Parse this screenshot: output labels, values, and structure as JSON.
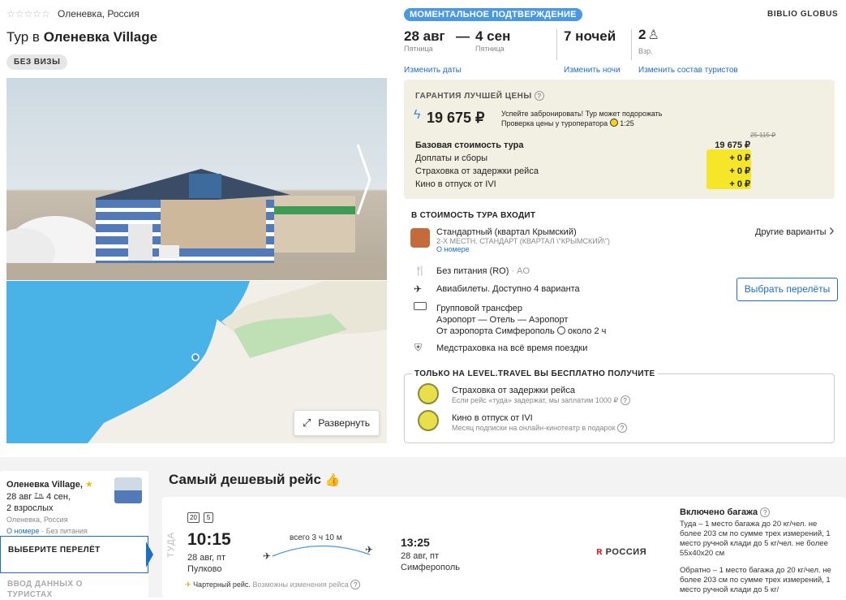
{
  "hotel": {
    "stars": "☆☆☆☆☆",
    "location": "Оленевка, Россия",
    "title_prefix": "Тур в",
    "title_name": "Оленевка Village",
    "visa_badge": "БЕЗ ВИЗЫ",
    "expand_label": "Развернуть"
  },
  "booking": {
    "instant_badge": "МОМЕНТАЛЬНОЕ ПОДТВЕРЖДЕНИЕ",
    "operator": "BIBLIO GLOBUS",
    "date_from": "28 авг",
    "date_from_day": "Пятница",
    "date_dash": "—",
    "date_to": "4 сен",
    "date_to_day": "Пятница",
    "nights": "7 ночей",
    "tourists_count": "2",
    "tourists_label": "Взр.",
    "change_dates": "Изменить даты",
    "change_nights": "Изменить ночи",
    "change_tourists": "Изменить состав туристов"
  },
  "price": {
    "guarantee": "ГАРАНТИЯ ЛУЧШЕЙ ЦЕНЫ",
    "qmark": "?",
    "main": "19 675 ₽",
    "warn_line1": "Успейте забронировать! Тур может подорожать",
    "warn_line2": "Проверка цены у туроператора",
    "warn_time": "1:25",
    "old_price": "25 115 ₽",
    "rows": [
      {
        "label": "Базовая стоимость тура",
        "value": "19 675 ₽"
      },
      {
        "label": "Доплаты и сборы",
        "value": "+ 0 ₽"
      },
      {
        "label": "Страховка от задержки рейса",
        "value": "+ 0 ₽"
      },
      {
        "label": "Кино в отпуск от IVI",
        "value": "+ 0 ₽"
      }
    ]
  },
  "included": {
    "heading": "В СТОИМОСТЬ ТУРА ВХОДИТ",
    "room": "Стандартный (квартал Крымский)",
    "room_sub": "2-Х МЕСТН. СТАНДАРТ (КВАРТАЛ \\\"КРЫМСКИЙ\\\")",
    "room_link": "О номере",
    "other_variants": "Другие варианты",
    "meal": "Без питания (RO)",
    "meal_code": "· AO",
    "flights": "Авиабилеты. Доступно 4 варианта",
    "choose_flights": "Выбрать перелёты",
    "transfer": "Групповой трансфер",
    "transfer_route": "Аэропорт — Отель — Аэропорт",
    "transfer_from": "От аэропорта Симферополь",
    "transfer_time": "около 2 ч",
    "insurance": "Медстраховка на всё время поездки"
  },
  "bonus": {
    "heading": "ТОЛЬКО НА LEVEL.TRAVEL ВЫ БЕСПЛАТНО ПОЛУЧИТЕ",
    "item1": "Страховка от задержки рейса",
    "item1_sub": "Если рейс «туда» задержат, мы заплатим 1000 ₽",
    "item2": "Кино в отпуск от IVI",
    "item2_sub": "Месяц подписки на онлайн-кинотеатр в подарок"
  },
  "summary": {
    "hotel": "Оленевка Village,",
    "dates_from": "28 авг",
    "nights_short": "7 н.",
    "dates_to": "4 сен,",
    "adults": "2 взрослых",
    "location": "Оленевка, Россия",
    "room_link": "О номере",
    "meal": "· Без питания",
    "step1": "ВЫБЕРИТЕ ПЕРЕЛЁТ",
    "step2": "ВВОД ДАННЫХ О ТУРИСТАХ"
  },
  "flight": {
    "heading": "Самый дешевый рейс",
    "direction": "ТУДА",
    "bag1": "20",
    "bag2": "5",
    "dep_time": "10:15",
    "dep_date": "28 авг, пт",
    "dep_airport": "Пулково",
    "duration": "всего 3 ч 10 м",
    "arr_time": "13:25",
    "arr_date": "28 авг, пт",
    "arr_airport": "Симферополь",
    "airline": "РОССИЯ",
    "charter": "Чартерный рейс.",
    "charter_note": "Возможны изменения рейса",
    "baggage_title": "Включено багажа",
    "baggage_to": "Туда – 1 место багажа до 20 кг/чел. не более 203 см по сумме трех измерений, 1 место ручной клади до 5 кг/чел. не более 55x40x20 см",
    "baggage_back": "Обратно – 1 место багажа до 20 кг/чел. не более 203 см по сумме трех измерений, 1 место ручной клади до 5 кг/"
  }
}
